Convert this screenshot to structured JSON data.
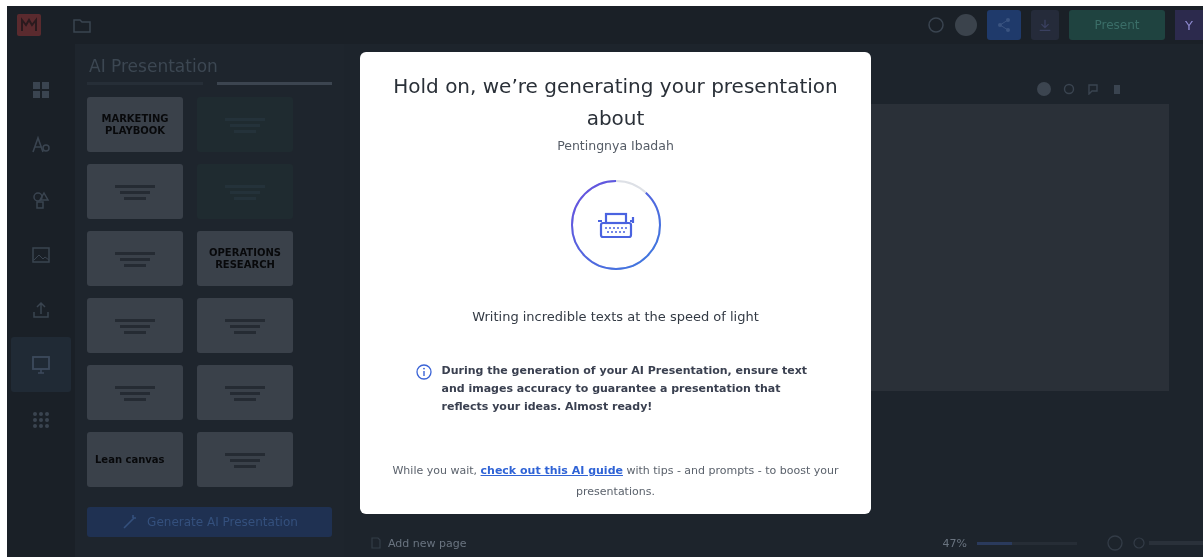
{
  "topbar": {
    "present_button": "Present",
    "avatar": "Y"
  },
  "rail": [
    {
      "kind": "templates",
      "selected": false
    },
    {
      "kind": "text",
      "selected": false
    },
    {
      "kind": "elements",
      "selected": false
    },
    {
      "kind": "photos",
      "selected": false
    },
    {
      "kind": "uploads",
      "selected": false
    },
    {
      "kind": "presentation",
      "selected": true
    },
    {
      "kind": "apps",
      "selected": false
    }
  ],
  "panel": {
    "title": "AI Presentation",
    "tabs": [
      {
        "selected": false
      },
      {
        "selected": true
      }
    ],
    "templates": [
      {
        "title": "MARKETING PLAYBOOK",
        "kind": "light"
      },
      {
        "kind": "dark"
      },
      {
        "kind": "light"
      },
      {
        "kind": "dark"
      },
      {
        "kind": "light"
      },
      {
        "title": "OPERATIONS RESEARCH",
        "kind": "light"
      },
      {
        "kind": "light"
      },
      {
        "kind": "light"
      },
      {
        "kind": "light"
      },
      {
        "kind": "light"
      },
      {
        "title": "Lean canvas",
        "kind": "light"
      },
      {
        "kind": "light"
      }
    ],
    "generate_button": "Generate AI Presentation"
  },
  "bottombar": {
    "add_page": "Add new page",
    "zoom": "47%",
    "zoom_slider": {
      "level": 0.35
    }
  },
  "modal": {
    "title": "Hold on, we’re generating your presentation about",
    "topic": "Pentingnya Ibadah",
    "status": "Writing incredible texts at the speed of light",
    "notice": "During the generation of your AI Presentation, ensure text and images accuracy to guarantee a presentation that reflects your ideas. Almost ready!",
    "footer_before": "While you wait,",
    "footer_link": "check out this AI guide",
    "footer_after": "with tips - and prompts - to boost your presentations."
  }
}
